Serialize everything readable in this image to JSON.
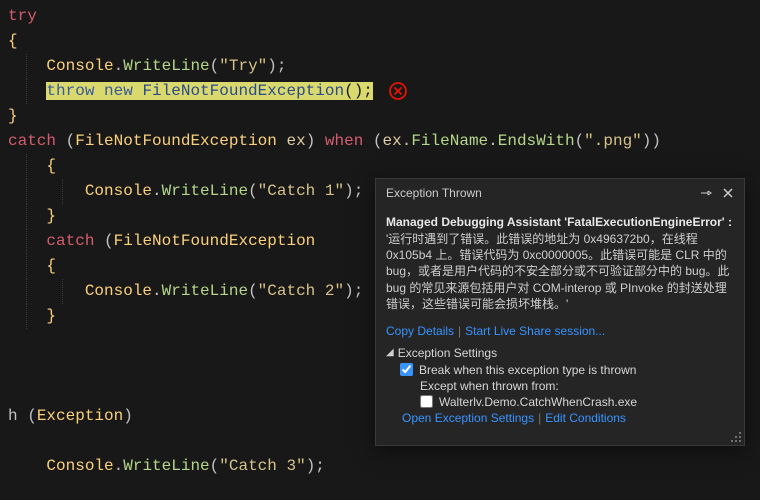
{
  "code": {
    "l1_kw": "try",
    "brace_open": "{",
    "brace_close": "}",
    "console": "Console",
    "dot": ".",
    "writeline": "WriteLine",
    "open_paren": "(",
    "close_paren": ")",
    "semi": ";",
    "str_try": "\"Try\"",
    "throw": "throw",
    "new": " new ",
    "filenotfound": "FileNotFoundException",
    "catch": "catch",
    "ex": "ex",
    "when": " when ",
    "filename": "FileName",
    "endswith": "EndsWith",
    "png": "\".png\"",
    "str_catch1": "\"Catch 1\"",
    "str_catch2": "\"Catch 2\"",
    "str_catch3": "\"Catch 3\"",
    "exception_type": "Exception",
    "catch_trunc": "h ("
  },
  "popup": {
    "title": "Exception Thrown",
    "msg_title": "Managed Debugging Assistant 'FatalExecutionEngineError' :",
    "msg_text": "'运行时遇到了错误。此错误的地址为 0x496372b0，在线程 0x105b4 上。错误代码为 0xc0000005。此错误可能是 CLR 中的 bug，或者是用户代码的不安全部分或不可验证部分中的 bug。此 bug 的常见来源包括用户对 COM-interop 或 PInvoke 的封送处理错误，这些错误可能会损坏堆栈。'",
    "copy_details": "Copy Details",
    "start_live_share": "Start Live Share session...",
    "settings_header": "Exception Settings",
    "break_when": "Break when this exception type is thrown",
    "except_from": "Except when thrown from:",
    "exe_name": "Walterlv.Demo.CatchWhenCrash.exe",
    "open_settings": "Open Exception Settings",
    "edit_conditions": "Edit Conditions"
  },
  "colors": {
    "link": "#3794ff",
    "bg": "#181818",
    "popup_bg": "#252526",
    "error_red": "#e51400"
  }
}
